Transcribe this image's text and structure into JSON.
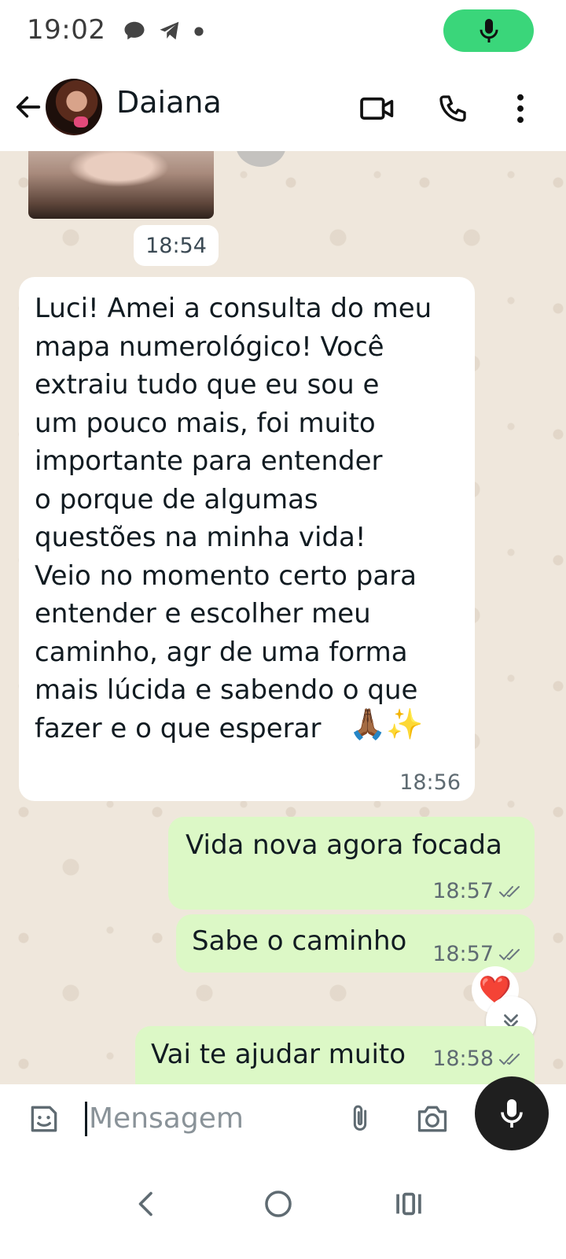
{
  "status_bar": {
    "time": "19:02",
    "icons": [
      "chat-bubble-icon",
      "telegram-icon",
      "dot-icon"
    ],
    "mic_indicator_color": "#3ad67a"
  },
  "header": {
    "contact_name": "Daiana",
    "icons": [
      "back-arrow-icon",
      "video-call-icon",
      "phone-call-icon",
      "more-options-icon"
    ]
  },
  "chat": {
    "image_message_time": "18:54",
    "incoming_message": {
      "text": "Luci! Amei a consulta do meu\nmapa numerológico! Você\nextraiu tudo que eu sou e\num pouco mais, foi muito\nimportante para entender\no porque de algumas\nquestões na minha vida!\nVeio no momento certo para\nentender e escolher meu\ncaminho, agr de uma forma\nmais lúcida e sabendo o que\nfazer e o que esperar",
      "emojis": "🙏🏾✨",
      "time": "18:56"
    },
    "outgoing_messages": [
      {
        "text": "Vida nova agora focada",
        "time": "18:57"
      },
      {
        "text": "Sabe o caminho",
        "time": "18:57"
      },
      {
        "text": "Vai te ajudar muito",
        "time": "18:58"
      }
    ],
    "reaction": "❤️"
  },
  "input": {
    "placeholder": "Mensagem",
    "icons": [
      "sticker-icon",
      "attach-icon",
      "camera-icon",
      "mic-icon"
    ]
  },
  "nav_bar": {
    "icons": [
      "nav-back-icon",
      "nav-home-icon",
      "nav-recents-icon"
    ]
  },
  "colors": {
    "outgoing_bubble": "#dcf8c6",
    "chat_background": "#efe7dc",
    "accent_green": "#3ad67a"
  }
}
